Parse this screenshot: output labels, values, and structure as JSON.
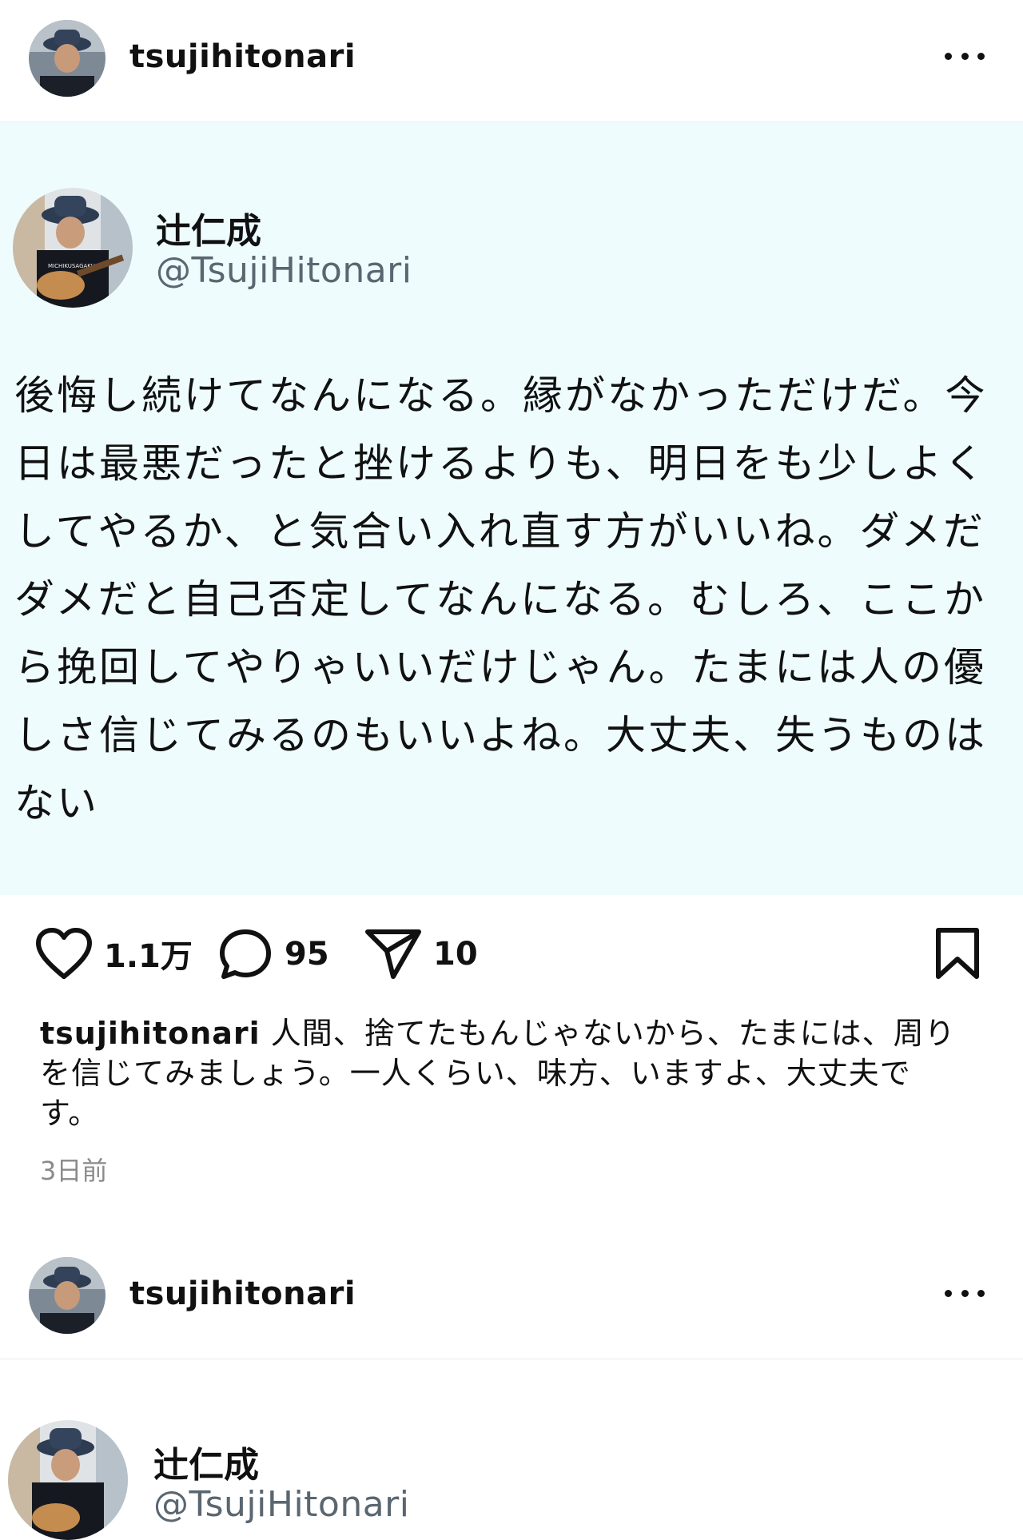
{
  "post1": {
    "username": "tsujihitonari",
    "tweet": {
      "name": "辻仁成",
      "handle": "@TsujiHitonari",
      "lines": [
        "後悔し続けてなんになる。縁がなかっただけだ。今",
        "日は最悪だったと挫けるよりも、明日をも少しよく",
        "してやるか、と気合い入れ直す方がいいね。ダメだ",
        "ダメだと自己否定してなんになる。むしろ、ここか",
        "ら挽回してやりゃいいだけじゃん。たまには人の優",
        "しさ信じてみるのもいいよね。大丈夫、失うものは",
        "ない"
      ]
    },
    "actions": {
      "likes": "1.1万",
      "comments": "95",
      "shares": "10"
    },
    "caption": {
      "username": "tsujihitonari",
      "line1": " 人間、捨てたもんじゃないから、たまには、周り",
      "line2": "を信じてみましょう。一人くらい、味方、いますよ、大丈夫で",
      "line3": "す。"
    },
    "timestamp": "3日前"
  },
  "post2": {
    "username": "tsujihitonari",
    "tweet": {
      "name": "辻仁成",
      "handle": "@TsujiHitonari"
    }
  }
}
